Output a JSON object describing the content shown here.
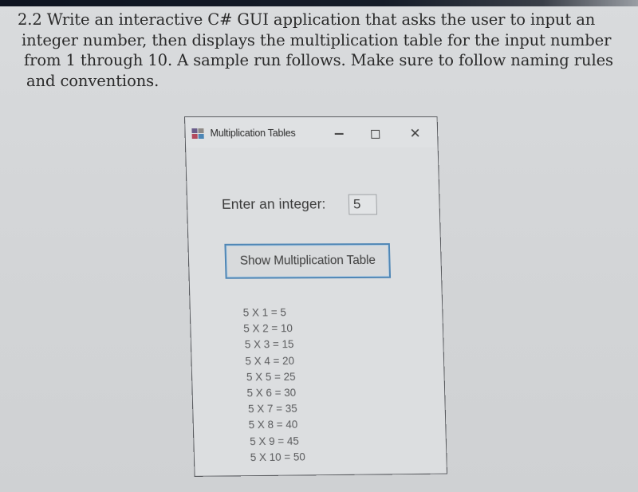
{
  "question": {
    "lines": [
      "2.2 Write an interactive C# GUI application that asks the user to input an",
      "integer number, then displays the multiplication table for the input number",
      "from 1 through 10. A sample run follows. Make sure to follow naming rules",
      "and conventions."
    ]
  },
  "window": {
    "title": "Multiplication Tables",
    "app_icon": "winforms-app-icon",
    "controls": {
      "minimize_icon": "minimize-icon",
      "maximize_icon": "maximize-icon",
      "close_icon": "close-icon",
      "close_glyph": "✕"
    },
    "prompt_label": "Enter an integer:",
    "input_value": "5",
    "button_label": "Show Multiplication Table",
    "results": [
      "5 X 1 = 5",
      "5 X 2 = 10",
      "5 X 3 = 15",
      "5 X 4 = 20",
      "5 X 5 = 25",
      "5 X 6 = 30",
      "5 X 7 = 35",
      "5 X 8 = 40",
      "5 X 9 = 45",
      "5 X 10 = 50"
    ]
  },
  "colors": {
    "button_border": "#4f86b5",
    "page_background": "#d6d8da",
    "window_border": "#5a5c60"
  }
}
